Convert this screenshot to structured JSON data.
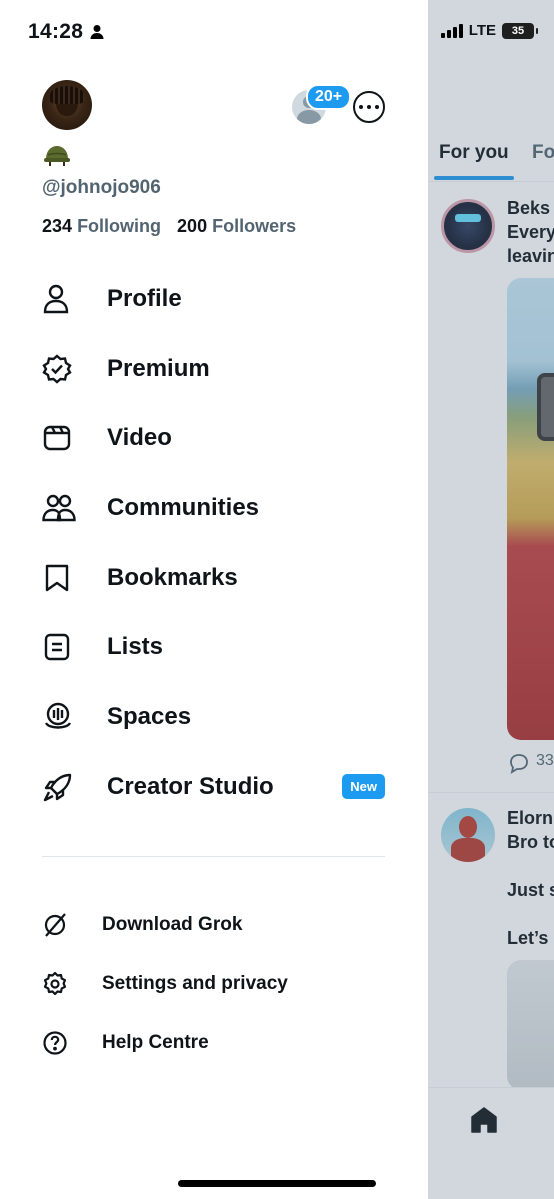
{
  "status_bar": {
    "time": "14:28",
    "network": "LTE",
    "battery": "35"
  },
  "drawer": {
    "account_badge": "20+",
    "handle": "@johnojo906",
    "following_count": "234",
    "following_label": "Following",
    "followers_count": "200",
    "followers_label": "Followers",
    "menu": [
      {
        "label": "Profile",
        "icon": "person-icon"
      },
      {
        "label": "Premium",
        "icon": "verified-badge-icon"
      },
      {
        "label": "Video",
        "icon": "video-icon"
      },
      {
        "label": "Communities",
        "icon": "communities-icon"
      },
      {
        "label": "Bookmarks",
        "icon": "bookmark-icon"
      },
      {
        "label": "Lists",
        "icon": "list-icon"
      },
      {
        "label": "Spaces",
        "icon": "spaces-icon"
      },
      {
        "label": "Creator Studio",
        "icon": "rocket-icon",
        "badge": "New"
      }
    ],
    "sub_menu": [
      {
        "label": "Download Grok",
        "icon": "grok-icon"
      },
      {
        "label": "Settings and privacy",
        "icon": "gear-icon"
      },
      {
        "label": "Help Centre",
        "icon": "help-icon"
      }
    ]
  },
  "feed": {
    "tabs": [
      "For you",
      "Fo"
    ],
    "post1_lines": [
      "Beks",
      "Every",
      "leavin"
    ],
    "post1_reply_count": "33",
    "post2_lines": [
      "Elorn",
      "Bro to"
    ],
    "post2_body": [
      "Just s",
      "Let’s"
    ]
  },
  "colors": {
    "accent": "#1d9bf0",
    "text": "#0f1419",
    "muted": "#536471"
  }
}
